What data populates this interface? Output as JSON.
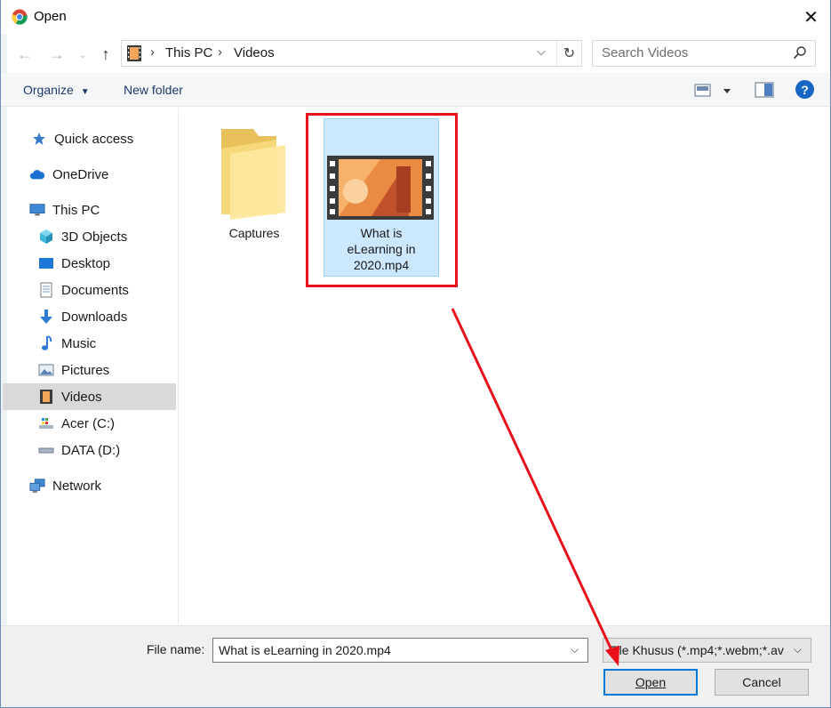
{
  "window": {
    "title": "Open",
    "close_glyph": "✕"
  },
  "address": {
    "breadcrumbs": [
      "This PC",
      "Videos"
    ],
    "search_placeholder": "Search Videos"
  },
  "commandbar": {
    "organize_label": "Organize",
    "new_folder_label": "New folder",
    "help_label": "?"
  },
  "sidebar": {
    "items": [
      {
        "label": "Quick access",
        "icon": "star-icon"
      },
      {
        "label": "OneDrive",
        "icon": "cloud-icon"
      },
      {
        "label": "This PC",
        "icon": "monitor-icon"
      },
      {
        "label": "3D Objects",
        "icon": "cube-icon"
      },
      {
        "label": "Desktop",
        "icon": "desktop-icon"
      },
      {
        "label": "Documents",
        "icon": "document-icon"
      },
      {
        "label": "Downloads",
        "icon": "download-icon"
      },
      {
        "label": "Music",
        "icon": "music-icon"
      },
      {
        "label": "Pictures",
        "icon": "pictures-icon"
      },
      {
        "label": "Videos",
        "icon": "videos-icon"
      },
      {
        "label": "Acer (C:)",
        "icon": "drive-c-icon"
      },
      {
        "label": "DATA (D:)",
        "icon": "drive-d-icon"
      },
      {
        "label": "Network",
        "icon": "network-icon"
      }
    ],
    "selected": "Videos"
  },
  "files": [
    {
      "name": "Captures",
      "type": "folder"
    },
    {
      "name_lines": [
        "What is",
        "eLearning in",
        "2020.mp4"
      ],
      "type": "video",
      "selected": true
    }
  ],
  "bottom": {
    "file_name_label": "File name:",
    "file_name_value": "What is eLearning in 2020.mp4",
    "file_type_value": "File Khusus (*.mp4;*.webm;*.av",
    "open_label": "Open",
    "cancel_label": "Cancel"
  },
  "colors": {
    "annotation_red": "#e8111b",
    "accent_blue": "#0078d7",
    "selection_bg": "#cce8ff"
  }
}
